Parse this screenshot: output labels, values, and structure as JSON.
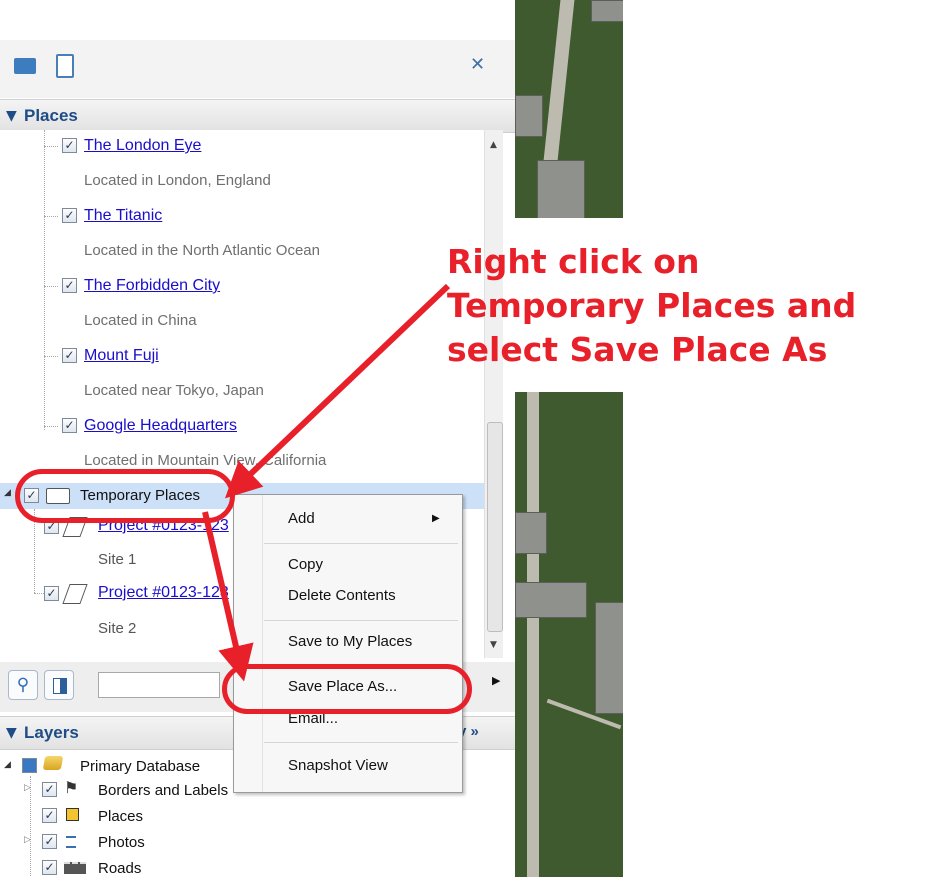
{
  "toolbar": {
    "add_folder_icon": "folder-add-icon",
    "paste_icon": "clipboard-icon",
    "close_label": "✕"
  },
  "places": {
    "header": "Places",
    "items": [
      {
        "label": "The London Eye",
        "desc": "Located in London, England",
        "checked": "✓"
      },
      {
        "label": "The Titanic",
        "desc": "Located in the North Atlantic Ocean",
        "checked": "✓"
      },
      {
        "label": "The Forbidden City",
        "desc": "Located in China",
        "checked": "✓"
      },
      {
        "label": "Mount Fuji",
        "desc": "Located near Tokyo, Japan",
        "checked": "✓"
      },
      {
        "label": "Google Headquarters",
        "desc": "Located in Mountain View, California",
        "checked": "✓"
      }
    ],
    "temp": {
      "label": "Temporary Places",
      "children": [
        {
          "label": "Project #0123-123",
          "desc": "Site 1"
        },
        {
          "label": "Project #0123-123",
          "desc": "Site 2"
        }
      ]
    }
  },
  "context_menu": {
    "items": [
      "Add",
      "Copy",
      "Delete Contents",
      "Save to My Places",
      "Save Place As...",
      "Email...",
      "Snapshot View"
    ],
    "submenu_arrow": "▶"
  },
  "search": {
    "value": ""
  },
  "layers": {
    "header": "Layers",
    "gallery_label": "y »",
    "items": [
      "Primary Database",
      "Borders and Labels",
      "Places",
      "Photos",
      "Roads"
    ]
  },
  "annotation": {
    "line1": "Right click on",
    "line2": "Temporary Places and",
    "line3": "select Save Place As",
    "color": "#e8202a"
  },
  "colors": {
    "header_text": "#1e4c86",
    "link": "#1a0dcc",
    "selection": "#cce0f8"
  }
}
